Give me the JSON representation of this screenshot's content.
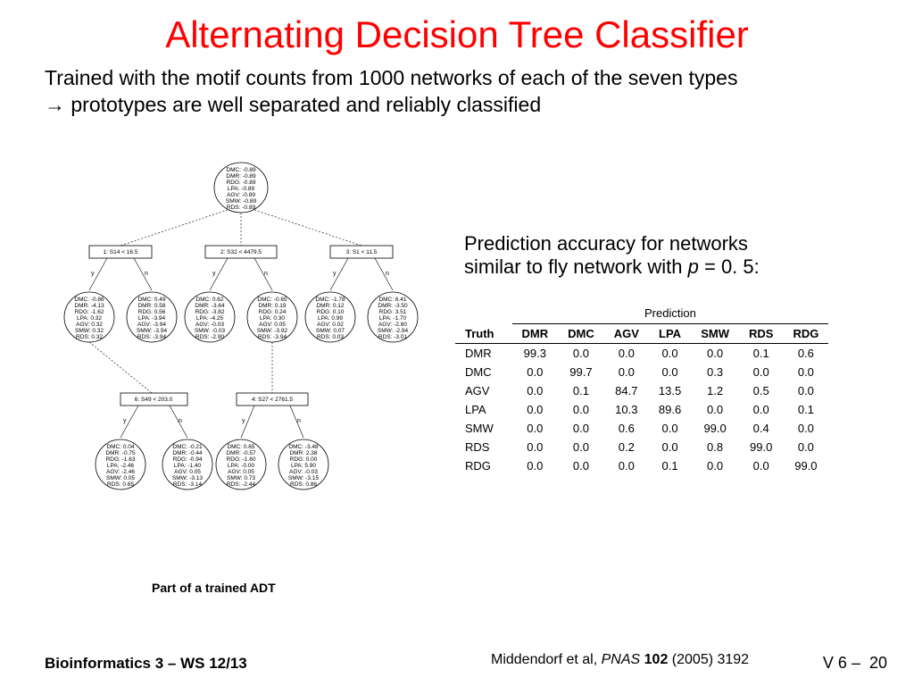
{
  "title": "Alternating Decision Tree Classifier",
  "subtitle_line1": "Trained with the motif counts from 1000 networks of each of the seven types",
  "subtitle_line2": "→ prototypes are well separated and reliably classified",
  "right_text_line1": "Prediction accuracy for networks",
  "right_text_line2": "similar to fly network with ",
  "right_text_p": "p",
  "right_text_eq": " = 0. 5:",
  "tree_caption": "Part of a trained ADT",
  "footer_left": "Bioinformatics 3 – WS 12/13",
  "footer_mid_author": "Middendorf et al, ",
  "footer_mid_journal": "PNAS",
  "footer_mid_vol": " 102",
  "footer_mid_rest": " (2005) 3192",
  "footer_right": "V 6  –",
  "footer_page": "20",
  "table": {
    "pred_label": "Prediction",
    "truth_label": "Truth",
    "cols": [
      "DMR",
      "DMC",
      "AGV",
      "LPA",
      "SMW",
      "RDS",
      "RDG"
    ],
    "rows": [
      {
        "n": "DMR",
        "v": [
          "99.3",
          "0.0",
          "0.0",
          "0.0",
          "0.0",
          "0.1",
          "0.6"
        ]
      },
      {
        "n": "DMC",
        "v": [
          "0.0",
          "99.7",
          "0.0",
          "0.0",
          "0.3",
          "0.0",
          "0.0"
        ]
      },
      {
        "n": "AGV",
        "v": [
          "0.0",
          "0.1",
          "84.7",
          "13.5",
          "1.2",
          "0.5",
          "0.0"
        ]
      },
      {
        "n": "LPA",
        "v": [
          "0.0",
          "0.0",
          "10.3",
          "89.6",
          "0.0",
          "0.0",
          "0.1"
        ]
      },
      {
        "n": "SMW",
        "v": [
          "0.0",
          "0.0",
          "0.6",
          "0.0",
          "99.0",
          "0.4",
          "0.0"
        ]
      },
      {
        "n": "RDS",
        "v": [
          "0.0",
          "0.0",
          "0.2",
          "0.0",
          "0.8",
          "99.0",
          "0.0"
        ]
      },
      {
        "n": "RDG",
        "v": [
          "0.0",
          "0.0",
          "0.0",
          "0.1",
          "0.0",
          "0.0",
          "99.0"
        ]
      }
    ]
  },
  "tree": {
    "root": [
      "DMC: -0.89",
      "DMR: -0.89",
      "RDG: -0.89",
      "LPA: -0.89",
      "AGV: -0.89",
      "SMW: -0.89",
      "RDS: -0.89"
    ],
    "split1": "1:  S14 < 16.5",
    "split2": "2:  S32 < 4479.5",
    "split3": "3:  S1 < 11.5",
    "split6": "6:  S49 < 203.0",
    "split4": "4:  S27 < 2761.5",
    "leaf_1y": [
      "DMC: -0.86",
      "DMR: -4.13",
      "RDG: -1.62",
      "LPA: 0.32",
      "AGV: 0.32",
      "SMW: 0.32",
      "RDS: 0.32"
    ],
    "leaf_1n": [
      "DMC: 0.49",
      "DMR: 0.58",
      "RDG: 0.56",
      "LPA: -3.94",
      "AGV: -3.94",
      "SMW: -3.94",
      "RDS: -3.94"
    ],
    "leaf_2y": [
      "DMC: 0.62",
      "DMR: -3.64",
      "RDG: -3.82",
      "LPA: -4.25",
      "AGV: -0.03",
      "SMW: -0.03",
      "RDS: -2.90"
    ],
    "leaf_2n": [
      "DMC: -0.65",
      "DMR: 0.19",
      "RDG: 0.24",
      "LPA: 0.30",
      "AGV: 0.05",
      "SMW: -3.92",
      "RDS: -3.94"
    ],
    "leaf_3y": [
      "DMC: -1.78",
      "DMR: 0.12",
      "RDG: 0.10",
      "LPA: 0.99",
      "AGV: 0.02",
      "SMW: 0.07",
      "RDS: 0.03"
    ],
    "leaf_3n": [
      "DMC: 6.41",
      "DMR: -3.50",
      "RDG: 3.51",
      "LPA: -1.70",
      "AGV: -2.80",
      "SMW: -2.94",
      "RDS: -3.01"
    ],
    "leaf_6y": [
      "DMC: 0.04",
      "DMR: -0.75",
      "RDG: -1.63",
      "LPA: -2.46",
      "AGV: -2.46",
      "SMW: 0.05",
      "RDS: 0.65"
    ],
    "leaf_6n": [
      "DMC: -0.21",
      "DMR: -0.44",
      "RDG: -0.94",
      "LPA: -1.40",
      "AGV: 0.05",
      "SMW: -3.13",
      "RDS: -3.14"
    ],
    "leaf_4y": [
      "DMC: 0.65",
      "DMR: -0.57",
      "RDG: -1.60",
      "LPA: -0.00",
      "AGV: 0.05",
      "SMW: 0.73",
      "RDS: -2.44"
    ],
    "leaf_4n": [
      "DMC: -3.48",
      "DMR: 2.38",
      "RDG: 0.00",
      "LPA: 5.90",
      "AGV: -0.03",
      "SMW: -3.15",
      "RDS: 0.86"
    ],
    "y": "y",
    "n": "n"
  }
}
